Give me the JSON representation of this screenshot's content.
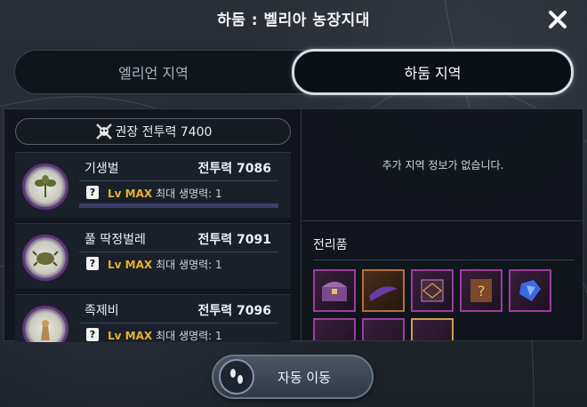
{
  "window": {
    "title": "하둠 : 벨리아 농장지대"
  },
  "tabs": [
    {
      "label": "엘리언 지역",
      "active": false
    },
    {
      "label": "하둠 지역",
      "active": true
    }
  ],
  "recommended": {
    "label": "권장 전투력 7400"
  },
  "monsters": [
    {
      "name": "기생벌",
      "power": "전투력 7086",
      "level": "Lv MAX",
      "hp": "최대 생명력: 1",
      "icon": "bee-plant-icon"
    },
    {
      "name": "풀 딱정벌레",
      "power": "전투력 7091",
      "level": "Lv MAX",
      "hp": "최대 생명력: 1",
      "icon": "beetle-icon"
    },
    {
      "name": "족제비",
      "power": "전투력 7096",
      "level": "Lv MAX",
      "hp": "최대 생명력: 1",
      "icon": "weasel-icon"
    }
  ],
  "region_info": {
    "empty_text": "추가 지역 정보가 없습니다."
  },
  "loot": {
    "title": "전리품",
    "items": [
      {
        "icon": "treasure-chest-icon",
        "grade": "purple"
      },
      {
        "icon": "purple-ribbon-icon",
        "grade": "orange"
      },
      {
        "icon": "magic-scroll-icon",
        "grade": "purple"
      },
      {
        "icon": "mystery-book-icon",
        "grade": "purple"
      },
      {
        "icon": "blue-crystal-icon",
        "grade": "purple"
      },
      {
        "icon": "dark-gem-icon",
        "grade": "purple"
      },
      {
        "icon": "purple-flame-icon",
        "grade": "purple"
      },
      {
        "icon": "star-emblem-icon",
        "grade": "gold"
      }
    ]
  },
  "auto_move": {
    "label": "자동 이동",
    "icon": "footsteps-icon"
  },
  "colors": {
    "accent_level": "#e7b330",
    "loot_border": "#9c3da0",
    "active_tab_border": "#d6dde6"
  }
}
